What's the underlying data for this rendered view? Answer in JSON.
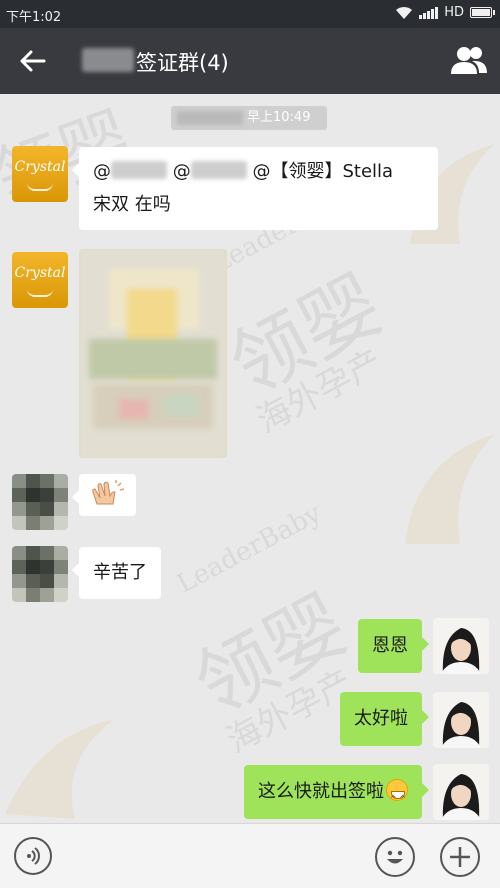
{
  "status_bar": {
    "time": "下午1:02",
    "network": "HD",
    "icons": [
      "wifi-icon",
      "signal-icon",
      "battery-icon"
    ]
  },
  "header": {
    "back_icon": "arrow-left-icon",
    "title": "签证群(4)",
    "group_icon": "group-members-icon"
  },
  "chat": {
    "timestamp": "早上10:49",
    "watermark": {
      "brand": "LeaderBaby",
      "name": "领婴",
      "slogan": "海外孕产"
    },
    "messages": [
      {
        "sender": "Crystal",
        "side": "left",
        "type": "text",
        "line1_mention_1": "@",
        "line1_mention_2": "@",
        "line1_rest": "@【领婴】Stella",
        "line2": "宋双 在吗"
      },
      {
        "sender": "Crystal",
        "side": "left",
        "type": "image"
      },
      {
        "sender": "member",
        "side": "left",
        "type": "emoji",
        "emoji": "clapping-hands-icon"
      },
      {
        "sender": "member",
        "side": "left",
        "type": "text",
        "text": "辛苦了"
      },
      {
        "sender": "me",
        "side": "right",
        "type": "text",
        "text": "恩恩"
      },
      {
        "sender": "me",
        "side": "right",
        "type": "text",
        "text": "太好啦"
      },
      {
        "sender": "me",
        "side": "right",
        "type": "text",
        "text": "这么快就出签啦",
        "emoji": "grinning-face-icon"
      }
    ]
  },
  "input_bar": {
    "voice_icon": "voice-icon",
    "emoji_icon": "smiley-icon",
    "more_icon": "plus-icon"
  }
}
